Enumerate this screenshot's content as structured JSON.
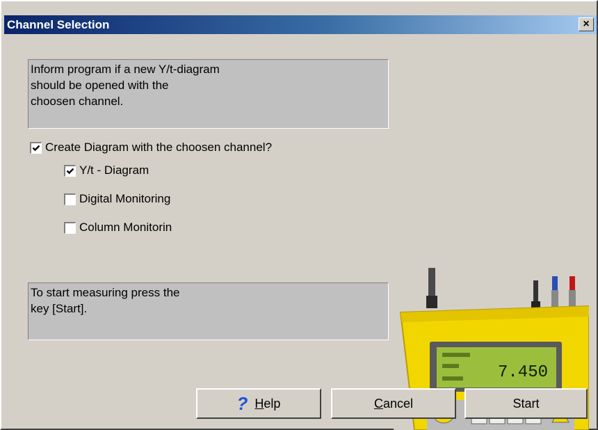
{
  "window": {
    "title": "Channel Selection",
    "close_label": "×"
  },
  "info_top": "Inform program if a new Y/t-diagram\nshould be opened with the\nchoosen channel.",
  "create_diagram": {
    "label": "Create Diagram with the choosen channel?",
    "checked": true
  },
  "options": [
    {
      "label": "Y/t - Diagram",
      "checked": true
    },
    {
      "label": "Digital Monitoring",
      "checked": false
    },
    {
      "label": "Column Monitorin",
      "checked": false
    }
  ],
  "info_bottom": "To start measuring press the\nkey [Start].",
  "buttons": {
    "help_prefix": "",
    "help_mnemonic": "H",
    "help_rest": "elp",
    "cancel_mnemonic": "C",
    "cancel_rest": "ancel",
    "start": "Start"
  },
  "device_display": {
    "value": "7.450"
  },
  "colors": {
    "title_gradient_start": "#0a246a",
    "title_gradient_end": "#a6caf0",
    "dialog_bg": "#d4d0c8",
    "device_body": "#f2d600",
    "device_lcd": "#9bbf3c"
  },
  "icons": {
    "help": "question-mark-icon",
    "close": "close-icon",
    "check": "checkmark-icon"
  }
}
